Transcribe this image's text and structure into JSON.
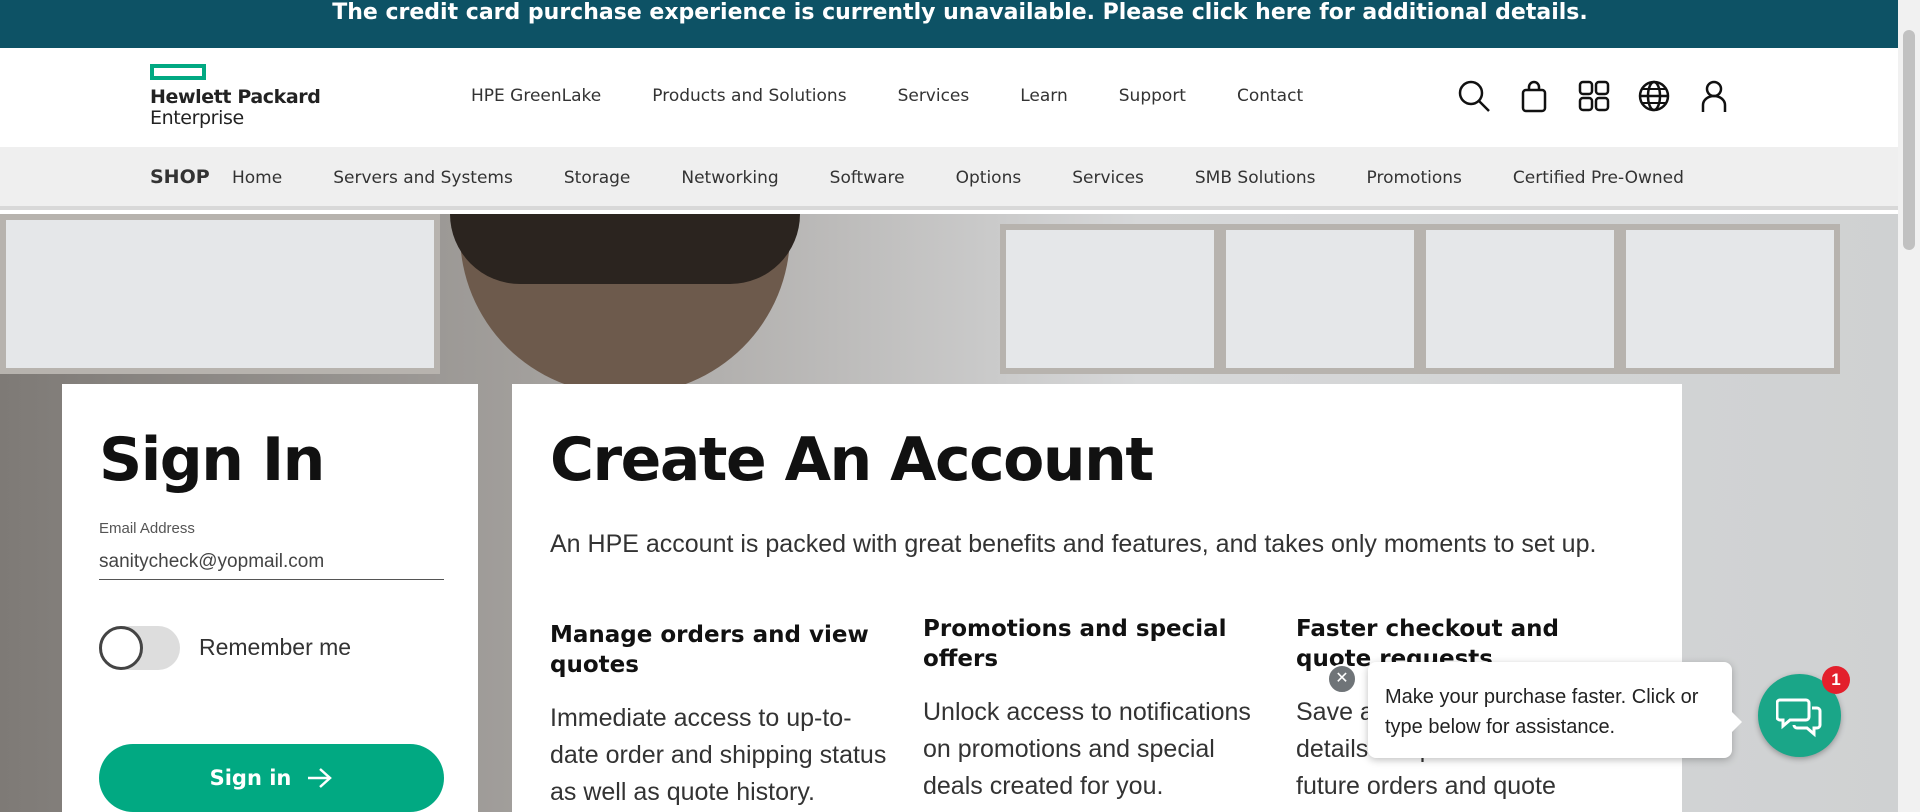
{
  "banner": {
    "text": "The credit card purchase experience is currently unavailable. Please click here for additional details."
  },
  "brand": {
    "line1": "Hewlett Packard",
    "line2": "Enterprise",
    "accent": "#01a982"
  },
  "main_nav": [
    "HPE GreenLake",
    "Products and Solutions",
    "Services",
    "Learn",
    "Support",
    "Contact"
  ],
  "header_icons": [
    "search-icon",
    "cart-icon",
    "apps-grid-icon",
    "globe-icon",
    "user-icon"
  ],
  "shop_nav": {
    "label": "SHOP",
    "items": [
      "Home",
      "Servers and Systems",
      "Storage",
      "Networking",
      "Software",
      "Options",
      "Services",
      "SMB Solutions",
      "Promotions",
      "Certified Pre-Owned"
    ]
  },
  "signin": {
    "title": "Sign In",
    "email_label": "Email Address",
    "email_value": "sanitycheck@yopmail.com",
    "remember_label": "Remember me",
    "remember_checked": false,
    "button_label": "Sign in"
  },
  "create": {
    "title": "Create An Account",
    "subtitle": "An HPE account is packed with great benefits and features, and takes only moments to set up.",
    "features": [
      {
        "title": "Manage orders and view quotes",
        "text": "Immediate access to up-to-date order and shipping status as well as quote history."
      },
      {
        "title": "Promotions and special offers",
        "text": "Unlock access to notifications on promotions and special deals created for you."
      },
      {
        "title": "Faster checkout and quote requests",
        "text": "Save addresses and payment details for quicker checkout on future orders and quote requests."
      }
    ]
  },
  "chat": {
    "message": "Make your purchase faster. Click or type below for assistance.",
    "badge_count": "1",
    "close_glyph": "✕"
  },
  "colors": {
    "banner_bg": "#0d5265",
    "primary": "#01a982",
    "badge": "#e3202c"
  }
}
